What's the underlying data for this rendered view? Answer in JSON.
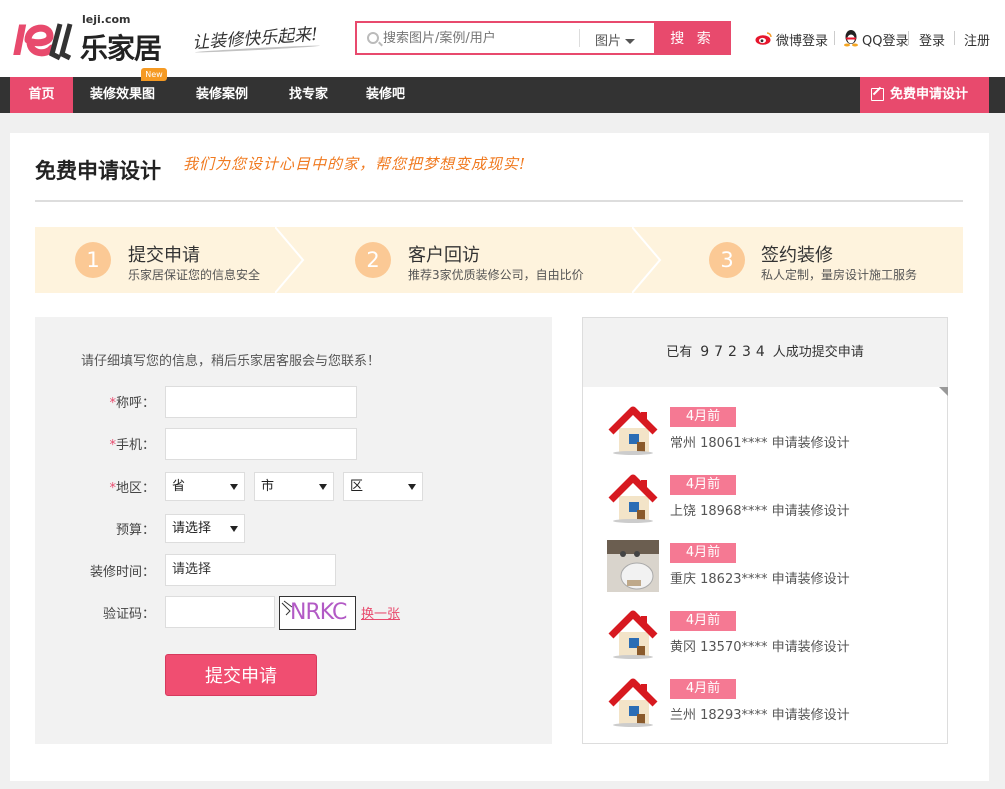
{
  "header": {
    "logo_domain": "leji.com",
    "logo_text": "乐家居",
    "slogan": "让装修快乐起来!",
    "search_placeholder": "搜索图片/案例/用户",
    "search_type": "图片",
    "search_button": "搜 索",
    "weibo_login": "微博登录",
    "qq_login": "QQ登录",
    "login": "登录",
    "register": "注册"
  },
  "nav": {
    "items": [
      "首页",
      "装修效果图",
      "装修案例",
      "找专家",
      "装修吧"
    ],
    "new_badge": "New",
    "apply_button": "免费申请设计"
  },
  "page": {
    "title": "免费申请设计",
    "subtitle": "我们为您设计心目中的家，帮您把梦想变成现实!"
  },
  "steps": [
    {
      "num": "1",
      "title": "提交申请",
      "desc": "乐家居保证您的信息安全"
    },
    {
      "num": "2",
      "title": "客户回访",
      "desc": "推荐3家优质装修公司，自由比价"
    },
    {
      "num": "3",
      "title": "签约装修",
      "desc": "私人定制，量房设计施工服务"
    }
  ],
  "form": {
    "hint": "请仔细填写您的信息，稍后乐家居客服会与您联系！",
    "required_mark": "*",
    "name_label": "称呼：",
    "phone_label": "手机：",
    "region_label": "地区：",
    "province": "省",
    "city": "市",
    "district": "区",
    "budget_label": "预算：",
    "budget_value": "请选择",
    "time_label": "装修时间：",
    "time_value": "请选择",
    "captcha_label": "验证码：",
    "captcha_text": "NRKC",
    "refresh": "换一张",
    "submit": "提交申请"
  },
  "right": {
    "prefix": "已有",
    "count": "97234",
    "suffix": "人成功提交申请",
    "items": [
      {
        "time": "4月前",
        "text": "常州 18061**** 申请装修设计"
      },
      {
        "time": "4月前",
        "text": "上饶 18968**** 申请装修设计"
      },
      {
        "time": "4月前",
        "text": "重庆 18623**** 申请装修设计"
      },
      {
        "time": "4月前",
        "text": "黄冈 13570**** 申请装修设计"
      },
      {
        "time": "4月前",
        "text": "兰州 18293**** 申请装修设计"
      }
    ]
  },
  "colors": {
    "brand": "#e84a6d",
    "nav_bg": "#333333",
    "step_bg": "#fef3dd",
    "step_circle": "#fbc995",
    "accent_orange": "#f07a20"
  }
}
